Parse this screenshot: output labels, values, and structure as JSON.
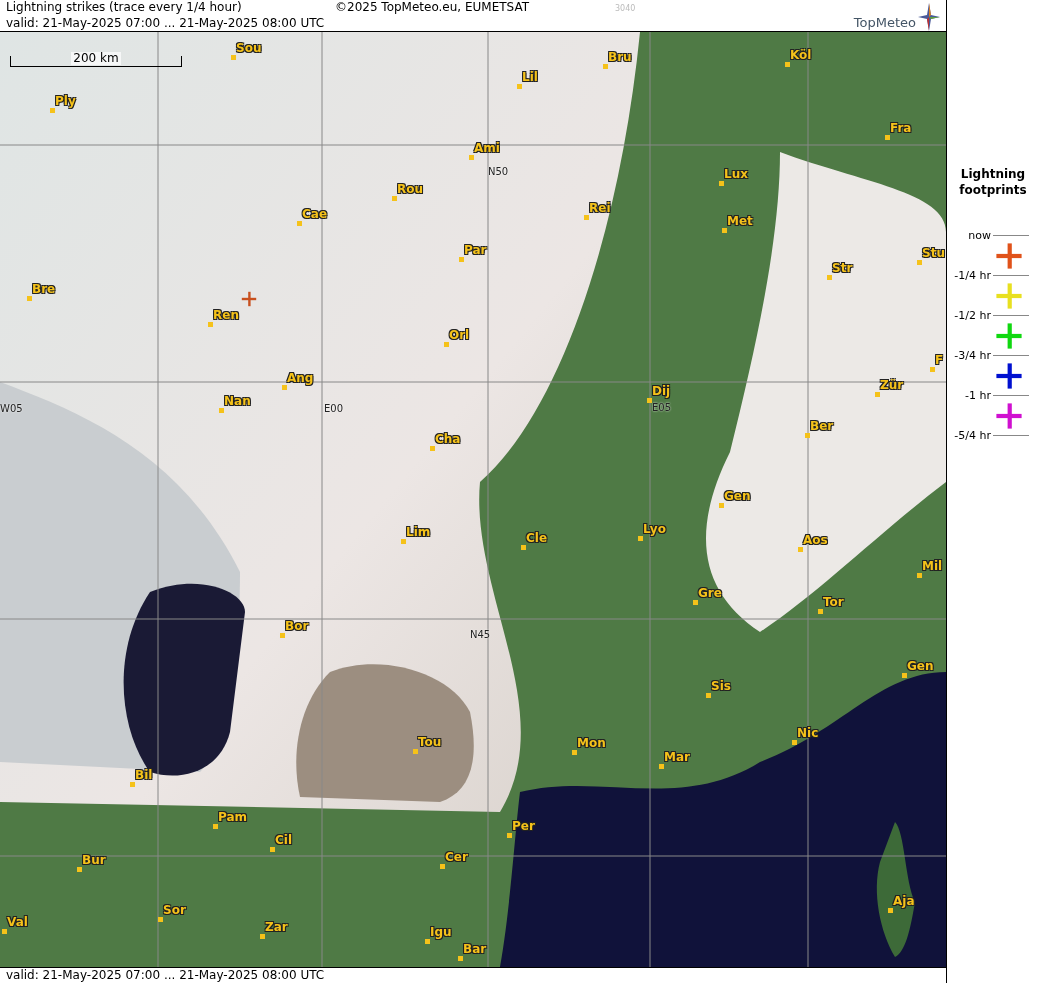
{
  "header": {
    "title": "Lightning strikes (trace every 1/4 hour)",
    "copyright": "©2025 TopMeteo.eu, EUMETSAT",
    "code": "3040",
    "valid": "valid:  21-May-2025 07:00 ... 21-May-2025 08:00 UTC",
    "logo": "TopMeteo"
  },
  "map": {
    "scale": "200 km",
    "grid_labels": [
      "N50",
      "W05",
      "E00",
      "E05",
      "N45"
    ],
    "cities": [
      "Sou",
      "Ply",
      "Lil",
      "Bru",
      "Köl",
      "Ami",
      "Fra",
      "Lux",
      "Rou",
      "Cae",
      "Rei",
      "Met",
      "Par",
      "Stu",
      "Str",
      "Bre",
      "Ren",
      "Orl",
      "F",
      "Ang",
      "Dij",
      "Zür",
      "Nan",
      "Ber",
      "Cha",
      "Gen",
      "Lim",
      "Cle",
      "Lyo",
      "Aos",
      "Mil",
      "Gre",
      "Tor",
      "Bor",
      "Gen",
      "Sis",
      "Nic",
      "Tou",
      "Mon",
      "Mar",
      "Bil",
      "Pam",
      "Per",
      "Cil",
      "Cer",
      "Bur",
      "Sor",
      "Aja",
      "Val",
      "Zar",
      "Igu",
      "Bar"
    ],
    "strikes": [
      {
        "color": "#c8501e"
      }
    ]
  },
  "footer": {
    "valid": "valid:  21-May-2025 07:00 ... 21-May-2025 08:00 UTC"
  },
  "legend": {
    "title": "Lightning footprints",
    "ticks": [
      "now",
      "-1/4 hr",
      "-1/2 hr",
      "-3/4 hr",
      "-1 hr",
      "-5/4 hr"
    ],
    "marks": [
      {
        "color": "#e0521a"
      },
      {
        "color": "#e8e020"
      },
      {
        "color": "#10d810"
      },
      {
        "color": "#0010d0"
      },
      {
        "color": "#d010d0"
      }
    ]
  }
}
